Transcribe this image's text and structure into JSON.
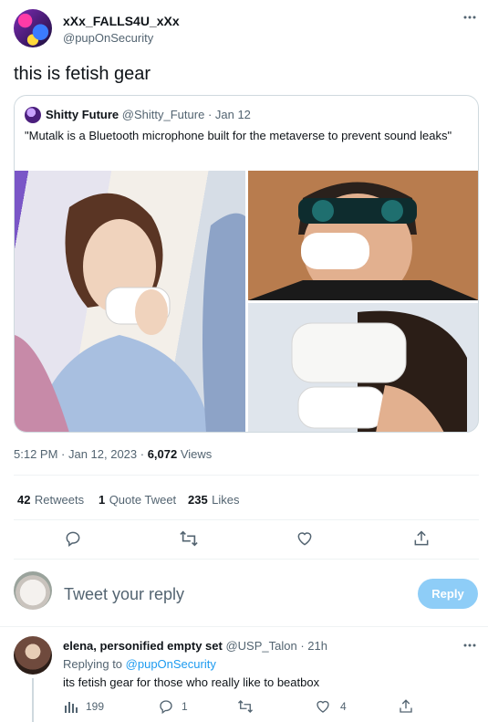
{
  "tweet": {
    "display_name": "xXx_FALLS4U_xXx",
    "handle": "@pupOnSecurity",
    "text": "this is fetish gear",
    "more_icon": "more-dots-icon"
  },
  "quote": {
    "display_name": "Shitty Future",
    "handle": "@Shitty_Future",
    "date": "· Jan 12",
    "text": "\"Mutalk is a Bluetooth microphone built for the metaverse to prevent sound leaks\""
  },
  "meta": {
    "time": "5:12 PM · Jan 12, 2023 · ",
    "views_count": "6,072",
    "views_label": " Views"
  },
  "stats": {
    "retweets_count": "42",
    "retweets_label": "Retweets",
    "quotes_count": "1",
    "quotes_label": "Quote Tweet",
    "likes_count": "235",
    "likes_label": "Likes"
  },
  "actions": [
    "reply-icon",
    "retweet-icon",
    "like-icon",
    "share-icon"
  ],
  "composer": {
    "placeholder": "Tweet your reply",
    "button": "Reply"
  },
  "reply": {
    "display_name": "elena, personified empty set",
    "handle": "@USP_Talon",
    "time": "· 21h",
    "replying_prefix": "Replying to ",
    "replying_to": "@pupOnSecurity",
    "text": "its fetish gear for those who really like to beatbox",
    "views": "199",
    "replies": "1",
    "retweets": "",
    "likes": "4"
  },
  "colors": {
    "accent": "#1d9bf0",
    "muted": "#536471",
    "reply_button": "#8ecdf7"
  }
}
